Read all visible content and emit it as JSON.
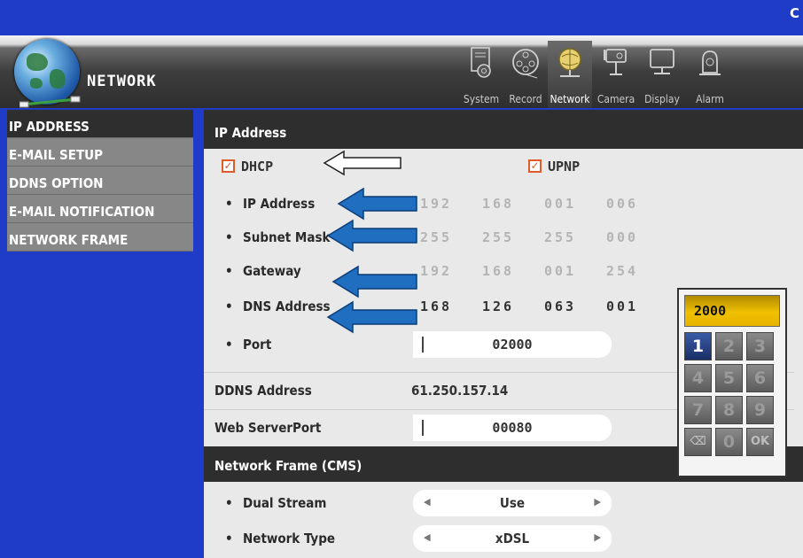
{
  "window": {
    "corner_text": "C"
  },
  "header": {
    "title": "NETWORK",
    "tabs": [
      {
        "label": "System",
        "icon": "gear-document-icon"
      },
      {
        "label": "Record",
        "icon": "film-reel-icon"
      },
      {
        "label": "Network",
        "icon": "network-icon",
        "active": true
      },
      {
        "label": "Camera",
        "icon": "camera-icon"
      },
      {
        "label": "Display",
        "icon": "monitor-icon"
      },
      {
        "label": "Alarm",
        "icon": "alarm-icon"
      }
    ]
  },
  "sidebar": {
    "items": [
      {
        "label": "IP ADDRESS",
        "active": true
      },
      {
        "label": "E-MAIL SETUP"
      },
      {
        "label": "DDNS OPTION"
      },
      {
        "label": "E-MAIL NOTIFICATION"
      },
      {
        "label": "NETWORK FRAME"
      }
    ]
  },
  "ip_section": {
    "title": "IP Address",
    "dhcp": {
      "label": "DHCP",
      "checked": true
    },
    "upnp": {
      "label": "UPNP",
      "checked": true
    },
    "rows": [
      {
        "label": "IP Address",
        "octets": [
          "192",
          "168",
          "001",
          "006"
        ],
        "dimmed": true
      },
      {
        "label": "Subnet Mask",
        "octets": [
          "255",
          "255",
          "255",
          "000"
        ],
        "dimmed": true
      },
      {
        "label": "Gateway",
        "octets": [
          "192",
          "168",
          "001",
          "254"
        ],
        "dimmed": true
      },
      {
        "label": "DNS Address",
        "octets": [
          "168",
          "126",
          "063",
          "001"
        ],
        "dimmed": false
      }
    ],
    "port": {
      "label": "Port",
      "value": "02000"
    },
    "ddns_address": {
      "label": "DDNS Address",
      "value": "61.250.157.14"
    },
    "web_server_port": {
      "label": "Web ServerPort",
      "value": "00080"
    }
  },
  "network_frame": {
    "title": "Network Frame (CMS)",
    "dual_stream": {
      "label": "Dual Stream",
      "value": "Use"
    },
    "network_type": {
      "label": "Network Type",
      "value": "xDSL"
    }
  },
  "keypad": {
    "display": "2000",
    "keys": [
      "1",
      "2",
      "3",
      "4",
      "5",
      "6",
      "7",
      "8",
      "9",
      "⌫",
      "0",
      "OK"
    ],
    "selected_key": "1"
  },
  "colors": {
    "background_blue": "#1e3cc8",
    "annotation_arrow_blue": "#1f6ec0",
    "checkbox_orange": "#e05a2a",
    "keypad_display_yellow": "#f0c000"
  }
}
